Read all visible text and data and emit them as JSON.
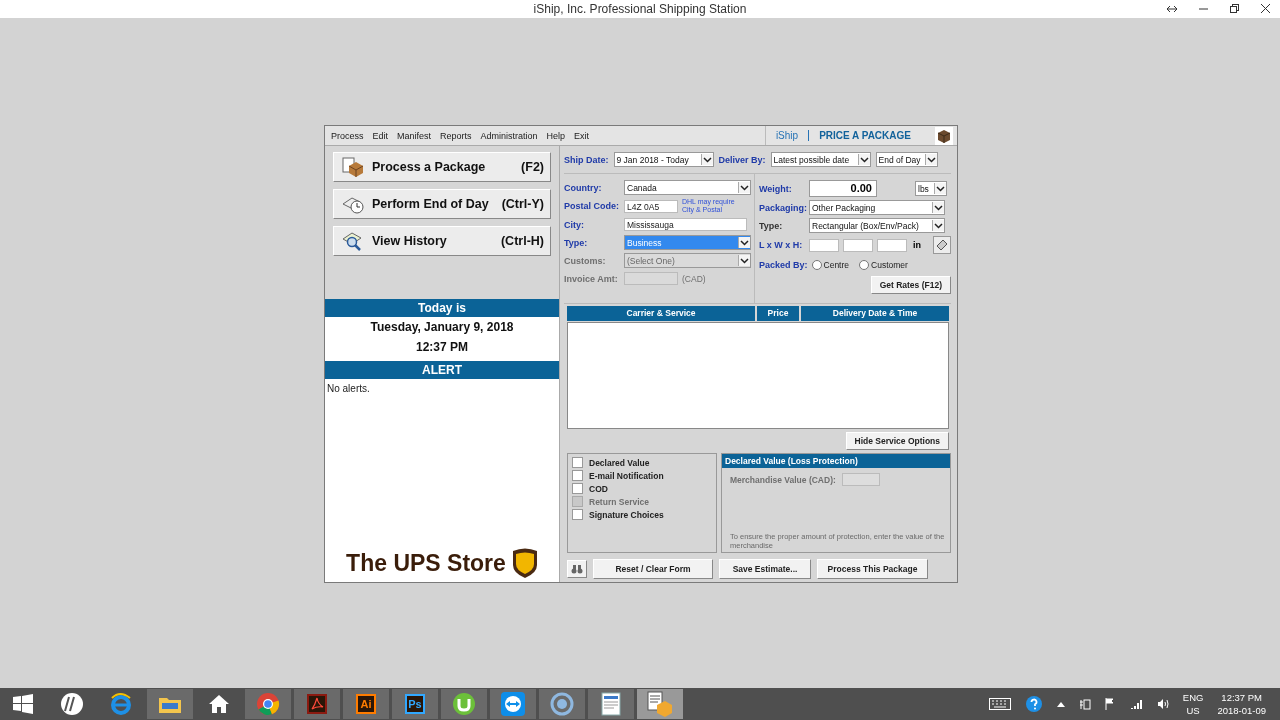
{
  "window": {
    "title": "iShip, Inc. Professional Shipping Station"
  },
  "menu": [
    "Process",
    "Edit",
    "Manifest",
    "Reports",
    "Administration",
    "Help",
    "Exit"
  ],
  "brand": {
    "logo": "iShip",
    "mode": "PRICE A PACKAGE"
  },
  "actions": [
    {
      "label": "Process a Package",
      "shortcut": "(F2)",
      "kind": "package"
    },
    {
      "label": "Perform End of Day",
      "shortcut": "(Ctrl-Y)",
      "kind": "clock"
    },
    {
      "label": "View History",
      "shortcut": "(Ctrl-H)",
      "kind": "search"
    }
  ],
  "today": {
    "heading": "Today is",
    "date": "Tuesday, January 9, 2018",
    "time": "12:37 PM"
  },
  "alert": {
    "heading": "ALERT",
    "text": "No alerts."
  },
  "store_logo": "The UPS Store",
  "ship_date": {
    "label": "Ship Date:",
    "value": "9 Jan 2018 - Today"
  },
  "deliver_by": {
    "label": "Deliver By:",
    "value": "Latest possible date",
    "time": "End of Day"
  },
  "destination": [
    {
      "kind": "select",
      "label": "Country:",
      "value": "Canada",
      "disabled": false,
      "selected": false
    },
    {
      "kind": "text",
      "label": "Postal Code:",
      "value": "L4Z 0A5",
      "note": "DHL may require City & Postal",
      "disabled": false,
      "selected": false
    },
    {
      "kind": "text",
      "label": "City:",
      "value": "Mississauga",
      "disabled": false,
      "selected": false
    },
    {
      "kind": "select",
      "label": "Type:",
      "value": "Business",
      "disabled": false,
      "selected": true
    },
    {
      "kind": "select",
      "label": "Customs:",
      "placeholder": "(Select One)",
      "disabled": true,
      "selected": false
    },
    {
      "kind": "text",
      "label": "Invoice Amt:",
      "suffix": "(CAD)",
      "disabled": true,
      "selected": false
    }
  ],
  "package": {
    "weight": {
      "label": "Weight:",
      "value": "0.00",
      "unit": "lbs"
    },
    "packaging": {
      "label": "Packaging:",
      "value": "Other Packaging"
    },
    "type": {
      "label": "Type:",
      "value": "Rectangular (Box/Env/Pack)"
    },
    "dimensions": {
      "label": "L x W x H:",
      "unit": "in"
    },
    "packed_by": {
      "label": "Packed By:",
      "options": [
        {
          "label": "Centre",
          "selected": false
        },
        {
          "label": "Customer",
          "selected": false
        }
      ]
    },
    "get_rates": "Get Rates (F12)"
  },
  "results": {
    "columns": [
      "Carrier & Service",
      "Price",
      "Delivery Date & Time"
    ],
    "toggle": "Hide Service Options"
  },
  "options": [
    {
      "label": "Declared Value",
      "checked": false,
      "disabled": false
    },
    {
      "label": "E-mail Notification",
      "checked": false,
      "disabled": false
    },
    {
      "label": "COD",
      "checked": false,
      "disabled": false
    },
    {
      "label": "Return Service",
      "checked": false,
      "disabled": true
    },
    {
      "label": "Signature Choices",
      "checked": false,
      "disabled": false
    }
  ],
  "declared": {
    "heading": "Declared Value (Loss Protection)",
    "field": "Merchandise Value (CAD):",
    "hint": "To ensure the proper amount of protection, enter the value of the merchandise"
  },
  "buttons": [
    "Reset / Clear Form",
    "Save Estimate...",
    "Process This Package"
  ],
  "taskbar": {
    "apps": [
      {
        "kind": "windows"
      },
      {
        "kind": "hp"
      },
      {
        "kind": "ie"
      },
      {
        "kind": "folder"
      },
      {
        "kind": "home"
      },
      {
        "kind": "chrome"
      },
      {
        "kind": "tile",
        "color": "#8b1a10"
      },
      {
        "kind": "tile",
        "label": "Ai",
        "color": "#ff7c00"
      },
      {
        "kind": "tile",
        "label": "Ps",
        "color": "#31a8ff"
      },
      {
        "kind": "torrent"
      },
      {
        "kind": "teamviewer"
      },
      {
        "kind": "ring"
      },
      {
        "kind": "doc"
      },
      {
        "kind": "package"
      }
    ],
    "lang": "ENG",
    "region": "US",
    "time": "12:37 PM",
    "date": "2018-01-09"
  }
}
